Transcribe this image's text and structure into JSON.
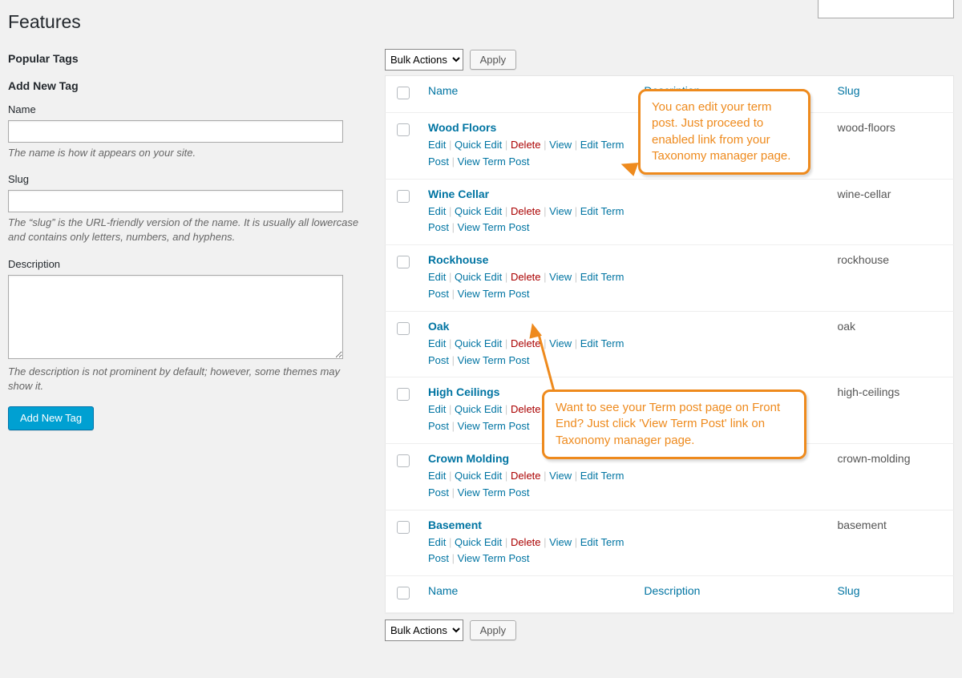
{
  "page": {
    "title": "Features"
  },
  "sidebar": {
    "popular_heading": "Popular Tags",
    "addnew_heading": "Add New Tag",
    "name_label": "Name",
    "name_value": "",
    "name_hint": "The name is how it appears on your site.",
    "slug_label": "Slug",
    "slug_value": "",
    "slug_hint": "The “slug” is the URL-friendly version of the name. It is usually all lowercase and contains only letters, numbers, and hyphens.",
    "desc_label": "Description",
    "desc_value": "",
    "desc_hint": "The description is not prominent by default; however, some themes may show it.",
    "submit_label": "Add New Tag"
  },
  "table": {
    "bulk_label": "Bulk Actions",
    "apply_label": "Apply",
    "col_name": "Name",
    "col_desc": "Description",
    "col_slug": "Slug",
    "actions": {
      "edit": "Edit",
      "quick_edit": "Quick Edit",
      "delete": "Delete",
      "view": "View",
      "edit_term": "Edit Term Post",
      "view_term": "View Term Post"
    },
    "rows": [
      {
        "name": "Wood Floors",
        "slug": "wood-floors"
      },
      {
        "name": "Wine Cellar",
        "slug": "wine-cellar"
      },
      {
        "name": "Rockhouse",
        "slug": "rockhouse"
      },
      {
        "name": "Oak",
        "slug": "oak"
      },
      {
        "name": "High Ceilings",
        "slug": "high-ceilings"
      },
      {
        "name": "Crown Molding",
        "slug": "crown-molding"
      },
      {
        "name": "Basement",
        "slug": "basement"
      }
    ]
  },
  "callouts": {
    "c1": "You can edit your term post. Just proceed to enabled link from your Taxonomy manager page.",
    "c2": "Want to see your Term post page on Front End? Just click 'View Term Post' link on Taxonomy manager page."
  },
  "search": {
    "value": ""
  }
}
